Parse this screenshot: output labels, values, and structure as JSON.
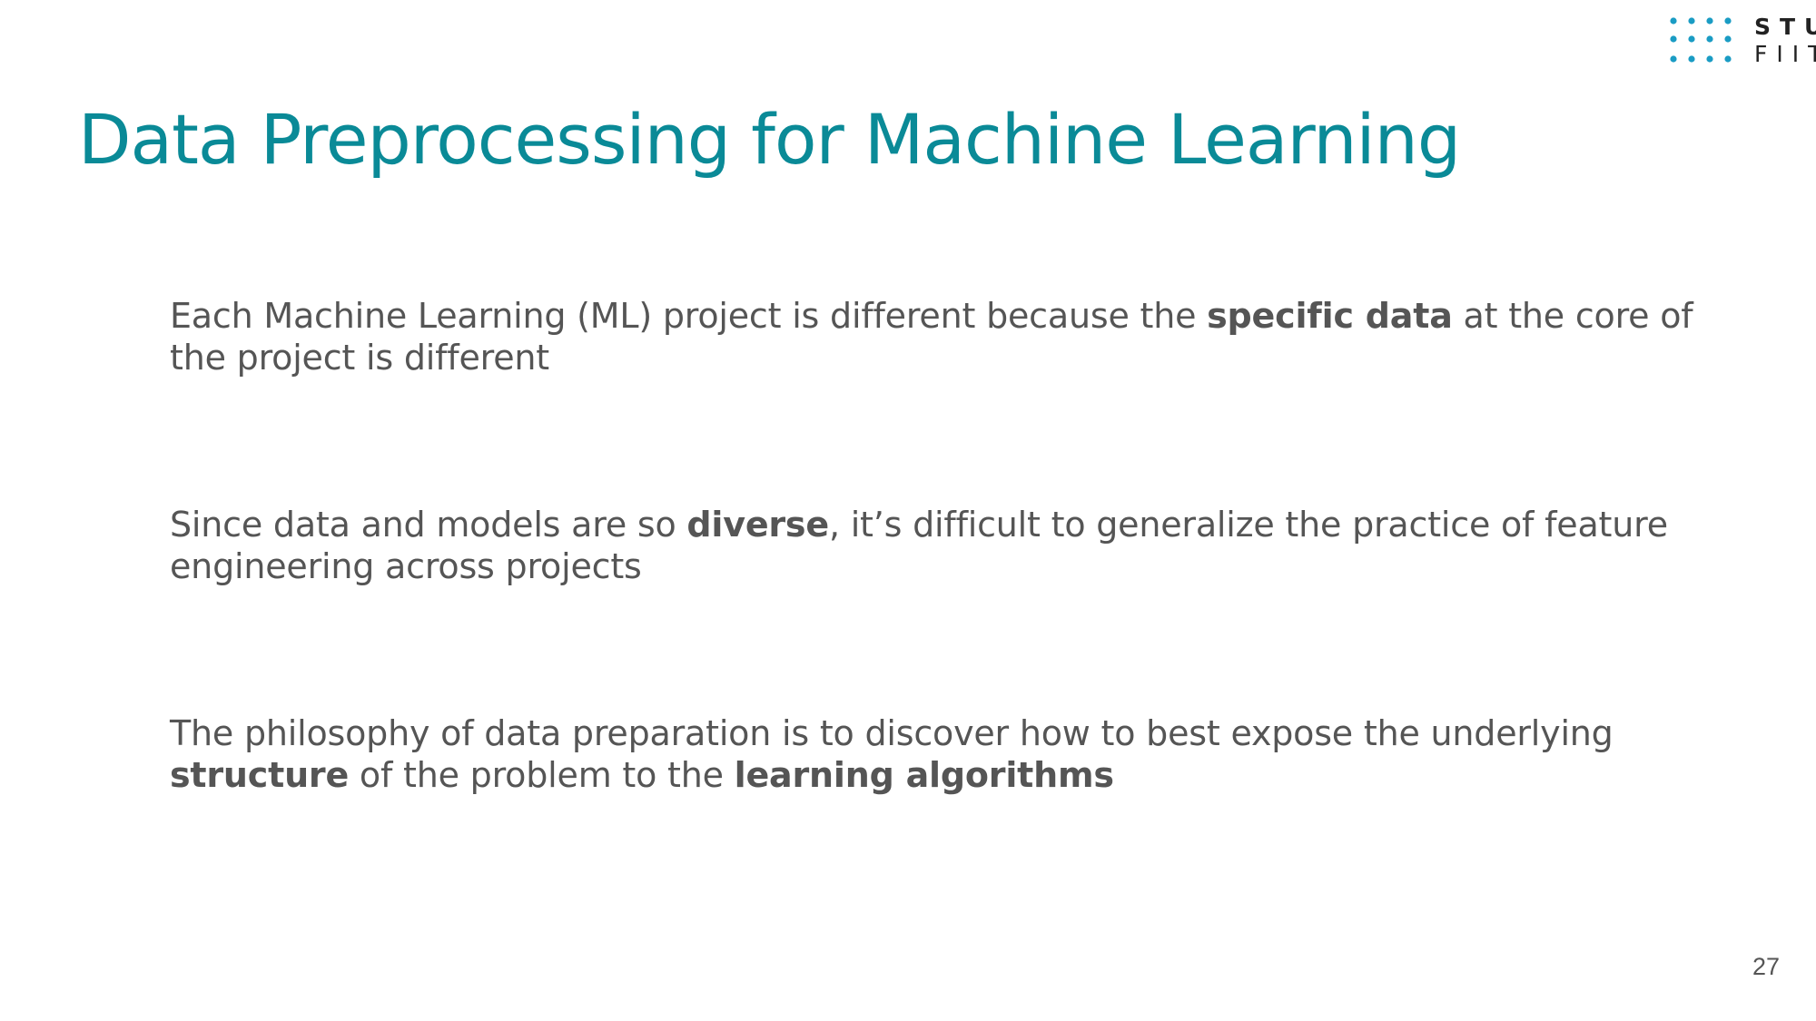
{
  "logo": {
    "line1": "STU",
    "line2": "FIIT",
    "dot_color": "#1a9cc4"
  },
  "slide": {
    "title": "Data Preprocessing for Machine Learning",
    "title_color": "#0a8a97",
    "text_color": "#555555",
    "paragraphs": [
      {
        "p1": "Each Machine Learning (ML) project is different because the ",
        "b1": "specific data",
        "p2": " at the core of the project is different"
      },
      {
        "p1": "Since data and models are so ",
        "b1": "diverse",
        "p2": ", it’s difficult to generalize the practice of feature engineering across projects"
      },
      {
        "p1": "The philosophy of data preparation is to discover how to best expose the underlying ",
        "b1": "structure",
        "p2": " of the problem to the ",
        "b2": "learning algorithms"
      }
    ],
    "page_number": "27"
  }
}
